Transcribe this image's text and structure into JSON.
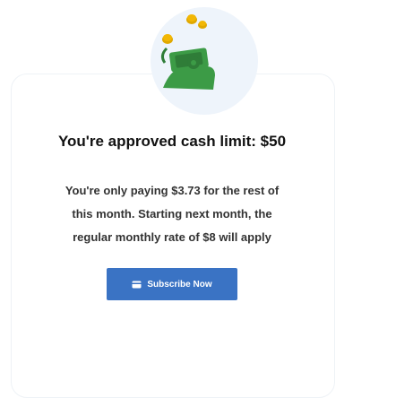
{
  "offer": {
    "headline": "You're approved cash limit: $50",
    "description": "You're only paying $3.73 for the rest of this month. Starting next month, the regular monthly rate of $8 will apply"
  },
  "subscribe_button": {
    "label": "Subscribe Now",
    "icon": "card-icon"
  },
  "illustration": {
    "icon": "money-hand-icon"
  },
  "colors": {
    "button_bg": "#3a73c4",
    "halo": "#eef4fb",
    "card_border": "#eef2f6",
    "coin": "#f2b705",
    "bill": "#3c9b46"
  }
}
